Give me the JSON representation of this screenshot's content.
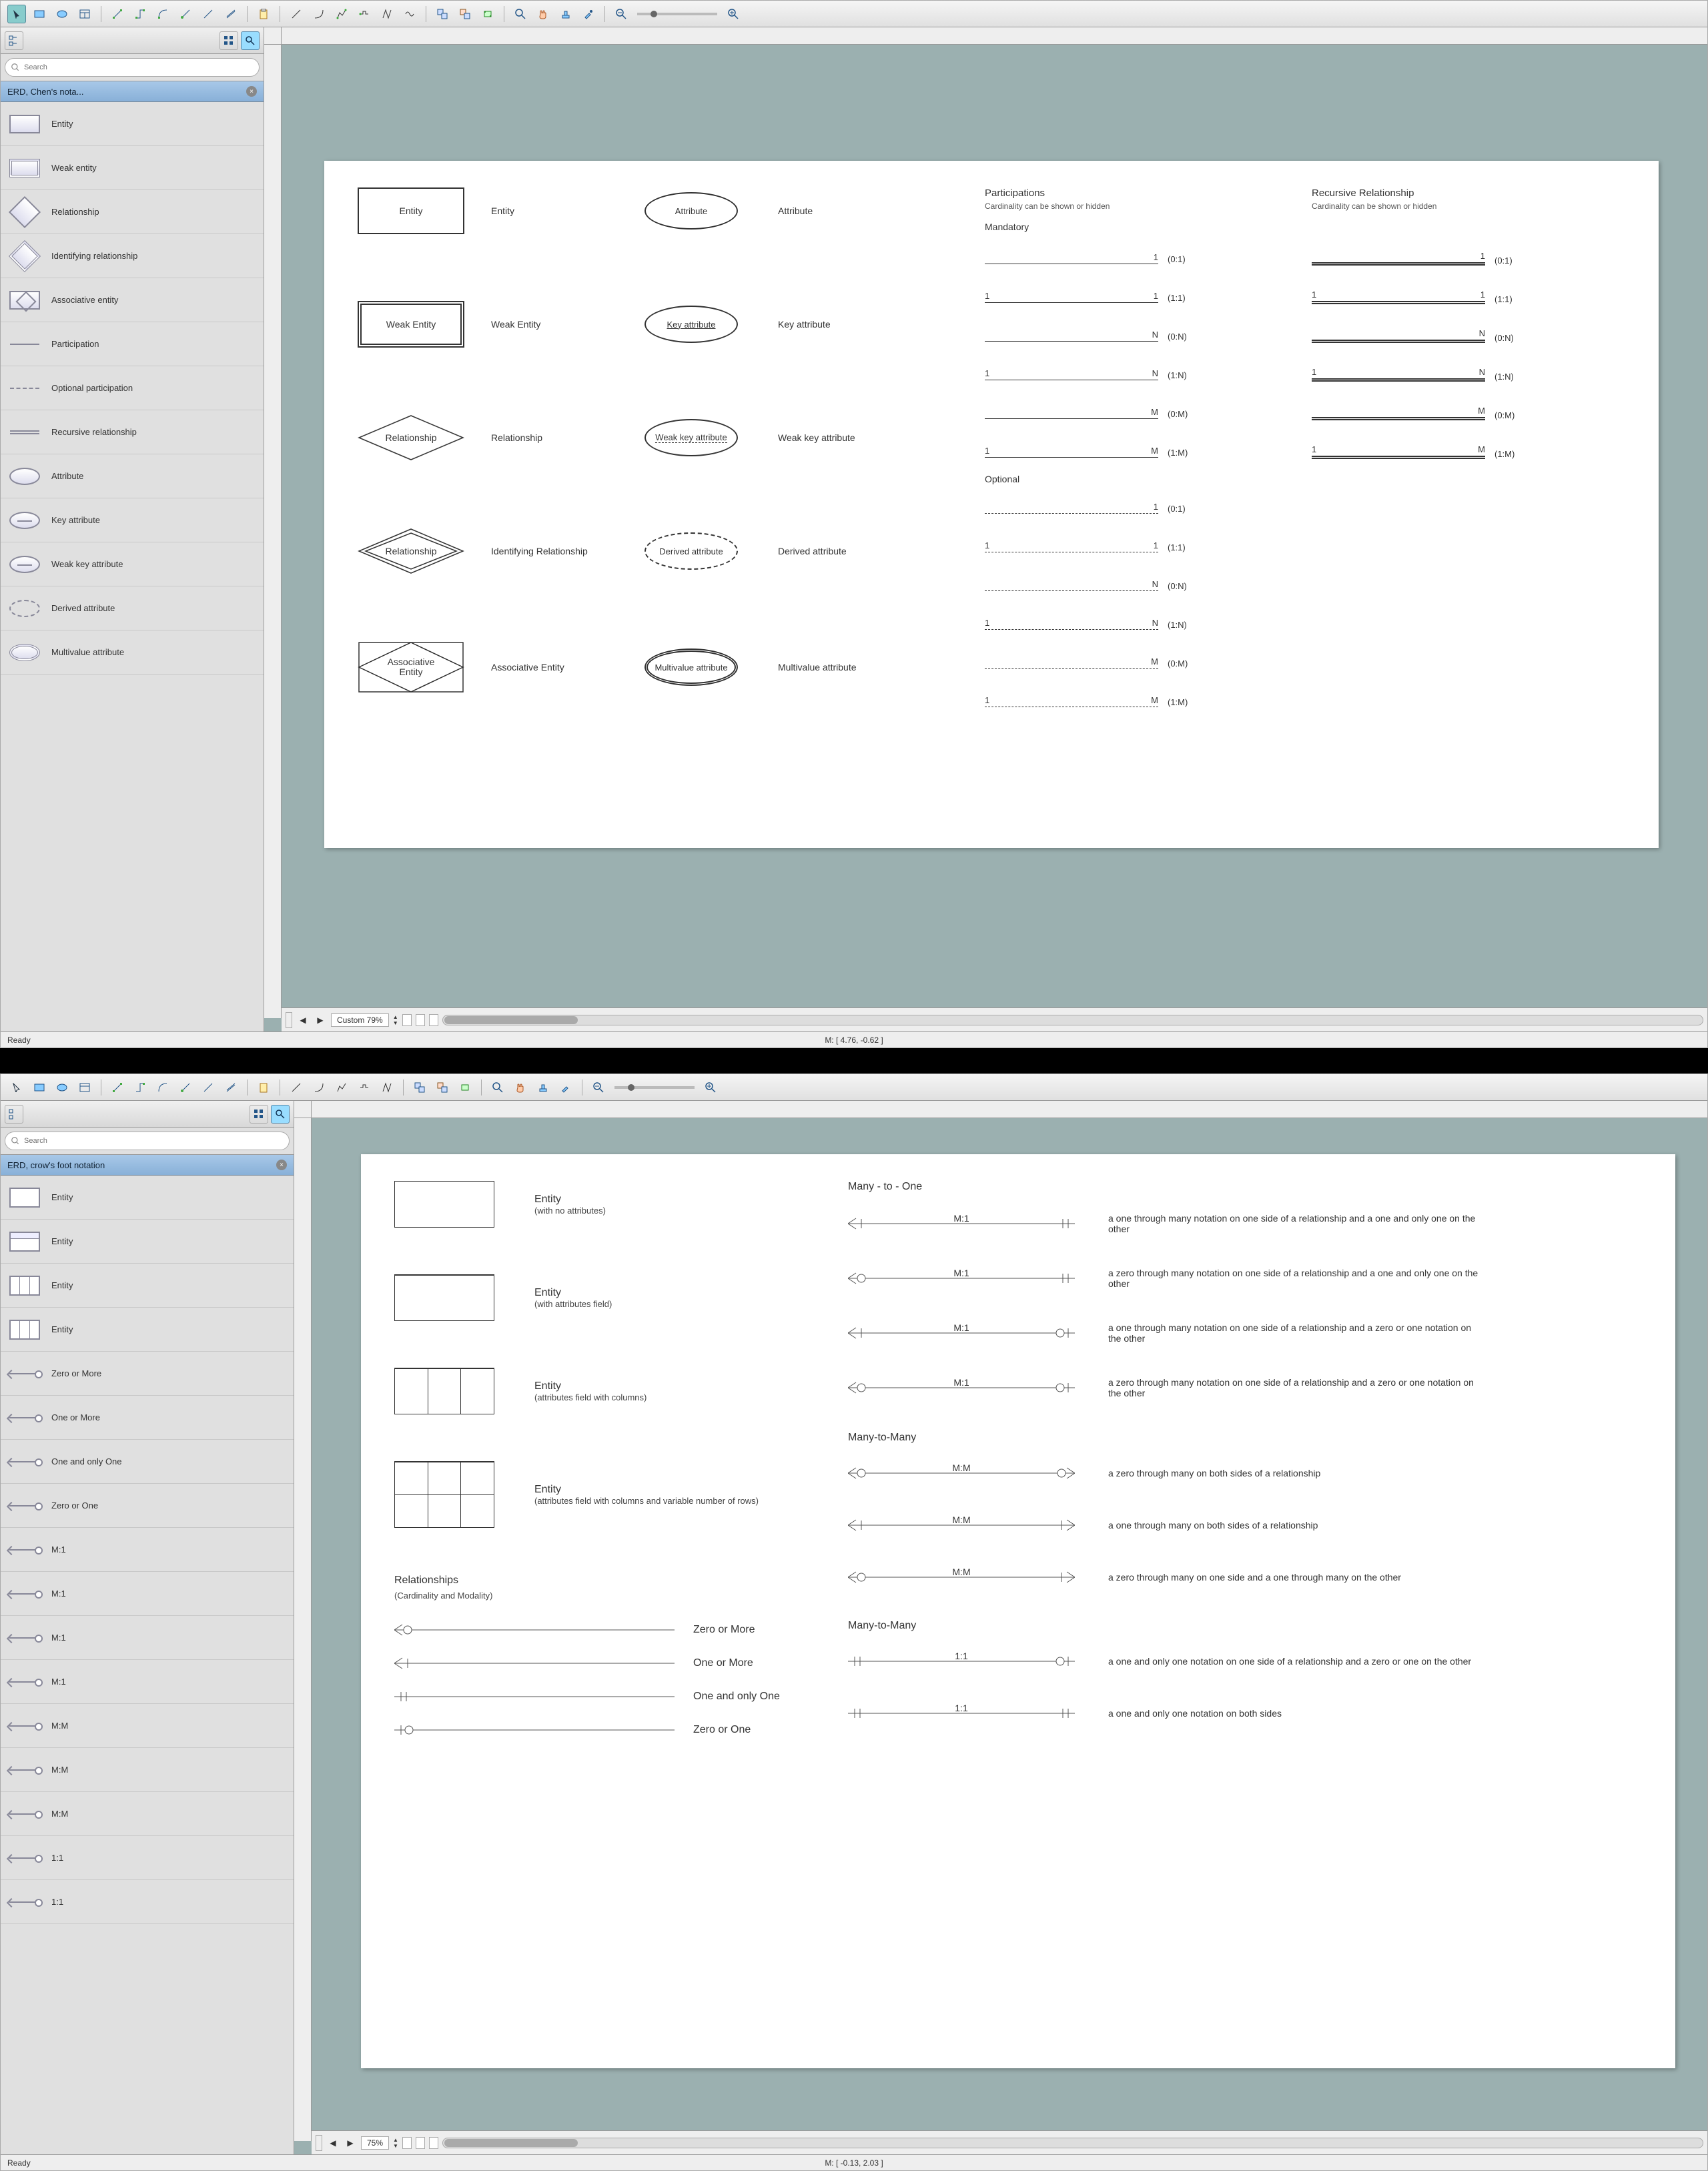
{
  "pane1": {
    "search_placeholder": "Search",
    "panel_title": "ERD, Chen's nota...",
    "items": [
      {
        "icon": "rect",
        "label": "Entity"
      },
      {
        "icon": "dblrect",
        "label": "Weak entity"
      },
      {
        "icon": "diamond",
        "label": "Relationship"
      },
      {
        "icon": "dbldia",
        "label": "Identifying relationship"
      },
      {
        "icon": "boxdia",
        "label": "Associative entity"
      },
      {
        "icon": "line",
        "label": "Participation"
      },
      {
        "icon": "dashline",
        "label": "Optional participation"
      },
      {
        "icon": "dblline",
        "label": "Recursive relationship"
      },
      {
        "icon": "oval",
        "label": "Attribute"
      },
      {
        "icon": "ovalul",
        "label": "Key attribute"
      },
      {
        "icon": "ovalul",
        "label": "Weak key attribute"
      },
      {
        "icon": "ovald",
        "label": "Derived attribute"
      },
      {
        "icon": "oval2",
        "label": "Multivalue attribute"
      }
    ],
    "canvas": {
      "row1": {
        "s1": "Entity",
        "l1": "Entity",
        "s2": "Attribute",
        "l2": "Attribute"
      },
      "row2": {
        "s1": "Weak Entity",
        "l1": "Weak Entity",
        "s2": "Key attribute",
        "l2": "Key attribute"
      },
      "row3": {
        "s1": "Relationship",
        "l1": "Relationship",
        "s2": "Weak key attribute",
        "l2": "Weak key attribute"
      },
      "row4": {
        "s1": "Relationship",
        "l1": "Identifying Relationship",
        "s2": "Derived attribute",
        "l2": "Derived attribute"
      },
      "row5": {
        "s1": "Associative Entity",
        "l1": "Associative Entity",
        "s2": "Multivalue attribute",
        "l2": "Multivalue attribute"
      },
      "part_head": "Participations",
      "part_sub": "Cardinality can be shown or hidden",
      "rec_head": "Recursive Relationship",
      "rec_sub": "Cardinality can be shown or hidden",
      "mandatory": "Mandatory",
      "optional": "Optional",
      "mand": [
        {
          "l": "",
          "r": "1",
          "t": "(0:1)"
        },
        {
          "l": "1",
          "r": "1",
          "t": "(1:1)"
        },
        {
          "l": "",
          "r": "N",
          "t": "(0:N)"
        },
        {
          "l": "1",
          "r": "N",
          "t": "(1:N)"
        },
        {
          "l": "",
          "r": "M",
          "t": "(0:M)"
        },
        {
          "l": "1",
          "r": "M",
          "t": "(1:M)"
        }
      ],
      "opt": [
        {
          "l": "",
          "r": "1",
          "t": "(0:1)"
        },
        {
          "l": "1",
          "r": "1",
          "t": "(1:1)"
        },
        {
          "l": "",
          "r": "N",
          "t": "(0:N)"
        },
        {
          "l": "1",
          "r": "N",
          "t": "(1:N)"
        },
        {
          "l": "",
          "r": "M",
          "t": "(0:M)"
        },
        {
          "l": "1",
          "r": "M",
          "t": "(1:M)"
        }
      ],
      "rec": [
        {
          "l": "",
          "r": "1",
          "t": "(0:1)"
        },
        {
          "l": "1",
          "r": "1",
          "t": "(1:1)"
        },
        {
          "l": "",
          "r": "N",
          "t": "(0:N)"
        },
        {
          "l": "1",
          "r": "N",
          "t": "(1:N)"
        },
        {
          "l": "",
          "r": "M",
          "t": "(0:M)"
        },
        {
          "l": "1",
          "r": "M",
          "t": "(1:M)"
        }
      ]
    },
    "zoom": "Custom 79%",
    "status_left": "Ready",
    "status_mid": "M: [ 4.76, -0.62 ]"
  },
  "pane2": {
    "search_placeholder": "Search",
    "panel_title": "ERD, crow's foot notation",
    "items": [
      {
        "icon": "entbox",
        "label": "Entity"
      },
      {
        "icon": "entboxh",
        "label": "Entity"
      },
      {
        "icon": "entboxc",
        "label": "Entity"
      },
      {
        "icon": "entboxr",
        "label": "Entity"
      },
      {
        "icon": "rel",
        "label": "Zero or More"
      },
      {
        "icon": "rel",
        "label": "One or More"
      },
      {
        "icon": "rel",
        "label": "One and only One"
      },
      {
        "icon": "rel",
        "label": "Zero or One"
      },
      {
        "icon": "rel",
        "label": "M:1"
      },
      {
        "icon": "rel",
        "label": "M:1"
      },
      {
        "icon": "rel",
        "label": "M:1"
      },
      {
        "icon": "rel",
        "label": "M:1"
      },
      {
        "icon": "rel",
        "label": "M:M"
      },
      {
        "icon": "rel",
        "label": "M:M"
      },
      {
        "icon": "rel",
        "label": "M:M"
      },
      {
        "icon": "rel",
        "label": "1:1"
      },
      {
        "icon": "rel",
        "label": "1:1"
      }
    ],
    "canvas": {
      "entities": [
        {
          "t": "Entity",
          "s": "(with no attributes)"
        },
        {
          "t": "Entity",
          "s": "(with attributes field)"
        },
        {
          "t": "Entity",
          "s": "(attributes field with columns)"
        },
        {
          "t": "Entity",
          "s": "(attributes field with columns and variable number of rows)"
        }
      ],
      "rel_head": "Relationships",
      "rel_sub": "(Cardinality and Modality)",
      "basics": [
        {
          "l": "Zero or More",
          "end": "zermore"
        },
        {
          "l": "One or More",
          "end": "onemore"
        },
        {
          "l": "One and only One",
          "end": "oneone"
        },
        {
          "l": "Zero or One",
          "end": "zeroone"
        }
      ],
      "mto_head": "Many - to - One",
      "mto": [
        {
          "m": "M:1",
          "left": "onemore",
          "right": "oneone",
          "d": "a one through many notation on one side of a relationship and a one and only one on the other"
        },
        {
          "m": "M:1",
          "left": "zermore",
          "right": "oneone",
          "d": "a zero through many notation on one side of a relationship and a one and only one on the other"
        },
        {
          "m": "M:1",
          "left": "onemore",
          "right": "zeroone",
          "d": "a one through many notation on one side of a relationship and a zero or one notation on the other"
        },
        {
          "m": "M:1",
          "left": "zermore",
          "right": "zeroone",
          "d": "a zero through many notation on one side of a relationship and a zero or one notation on the other"
        }
      ],
      "mtm_head": "Many-to-Many",
      "mtm": [
        {
          "m": "M:M",
          "left": "zermore",
          "right": "zermore_r",
          "d": "a zero through many on both sides of a relationship"
        },
        {
          "m": "M:M",
          "left": "onemore",
          "right": "onemore_r",
          "d": "a one through many on both sides of a relationship"
        },
        {
          "m": "M:M",
          "left": "zermore",
          "right": "onemore_r",
          "d": "a zero through many on one side and a one through many on the other"
        }
      ],
      "oto_head": "Many-to-Many",
      "oto": [
        {
          "m": "1:1",
          "left": "oneone",
          "right": "zeroone",
          "d": "a one and only one notation on one side of a relationship and a zero or one on the other"
        },
        {
          "m": "1:1",
          "left": "oneone",
          "right": "oneone",
          "d": "a one and only one notation on both sides"
        }
      ]
    },
    "zoom": "75%",
    "status_left": "Ready",
    "status_mid": "M: [ -0.13, 2.03 ]"
  }
}
